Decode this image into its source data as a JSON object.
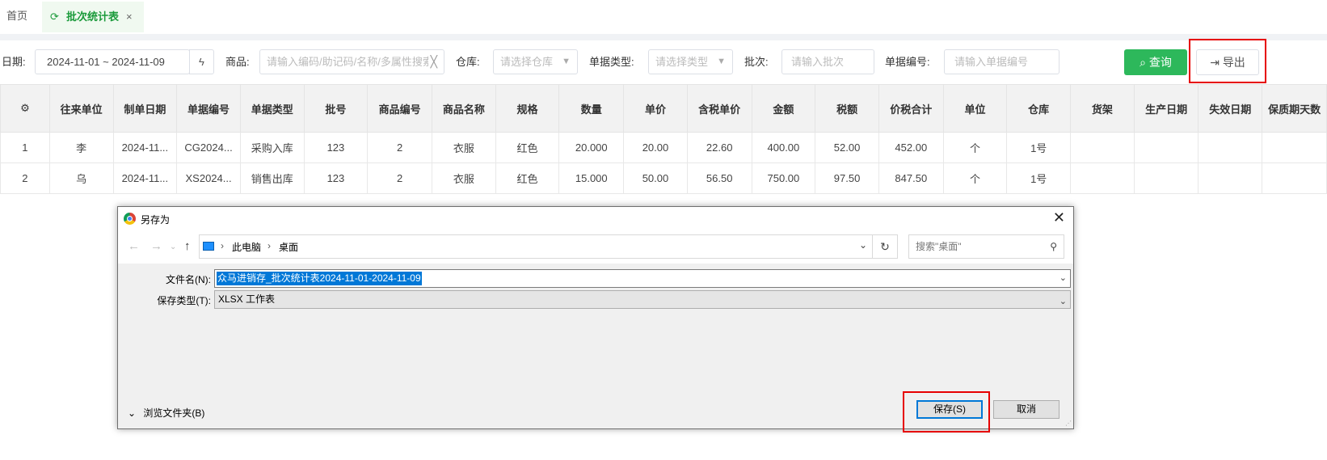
{
  "tabs": {
    "home": "首页",
    "active": "批次统计表",
    "refresh_icon": "refresh-icon",
    "close_icon": "close-icon"
  },
  "filters": {
    "date_label": "日期:",
    "date_value": "2024-11-01 ~ 2024-11-09",
    "product_label": "商品:",
    "product_placeholder": "请输入编码/助记码/名称/多属性搜索",
    "warehouse_label": "仓库:",
    "warehouse_placeholder": "请选择仓库",
    "doctype_label": "单据类型:",
    "doctype_placeholder": "请选择类型",
    "batch_label": "批次:",
    "batch_placeholder": "请输入批次",
    "docno_label": "单据编号:",
    "docno_placeholder": "请输入单据编号",
    "query_label": "查询",
    "export_label": "导出",
    "accent_color": "#2db85b"
  },
  "table": {
    "headers": [
      "⚙",
      "往来单位",
      "制单日期",
      "单据编号",
      "单据类型",
      "批号",
      "商品编号",
      "商品名称",
      "规格",
      "数量",
      "单价",
      "含税单价",
      "金额",
      "税额",
      "价税合计",
      "单位",
      "仓库",
      "货架",
      "生产日期",
      "失效日期",
      "保质期天数"
    ],
    "rows": [
      [
        "1",
        "李",
        "2024-11...",
        "CG2024...",
        "采购入库",
        "123",
        "2",
        "衣服",
        "红色",
        "20.000",
        "20.00",
        "22.60",
        "400.00",
        "52.00",
        "452.00",
        "个",
        "1号",
        "",
        "",
        "",
        ""
      ],
      [
        "2",
        "乌",
        "2024-11...",
        "XS2024...",
        "销售出库",
        "123",
        "2",
        "衣服",
        "红色",
        "15.000",
        "50.00",
        "56.50",
        "750.00",
        "97.50",
        "847.50",
        "个",
        "1号",
        "",
        "",
        "",
        ""
      ]
    ]
  },
  "dialog": {
    "title": "另存为",
    "path": [
      "此电脑",
      "桌面"
    ],
    "search_placeholder": "搜索\"桌面\"",
    "filename_label": "文件名(N):",
    "filename_value": "众马进销存_批次统计表2024-11-01-2024-11-09",
    "filetype_label": "保存类型(T):",
    "filetype_value": "XLSX 工作表",
    "browse_label": "浏览文件夹(B)",
    "save_label": "保存(S)",
    "cancel_label": "取消"
  }
}
